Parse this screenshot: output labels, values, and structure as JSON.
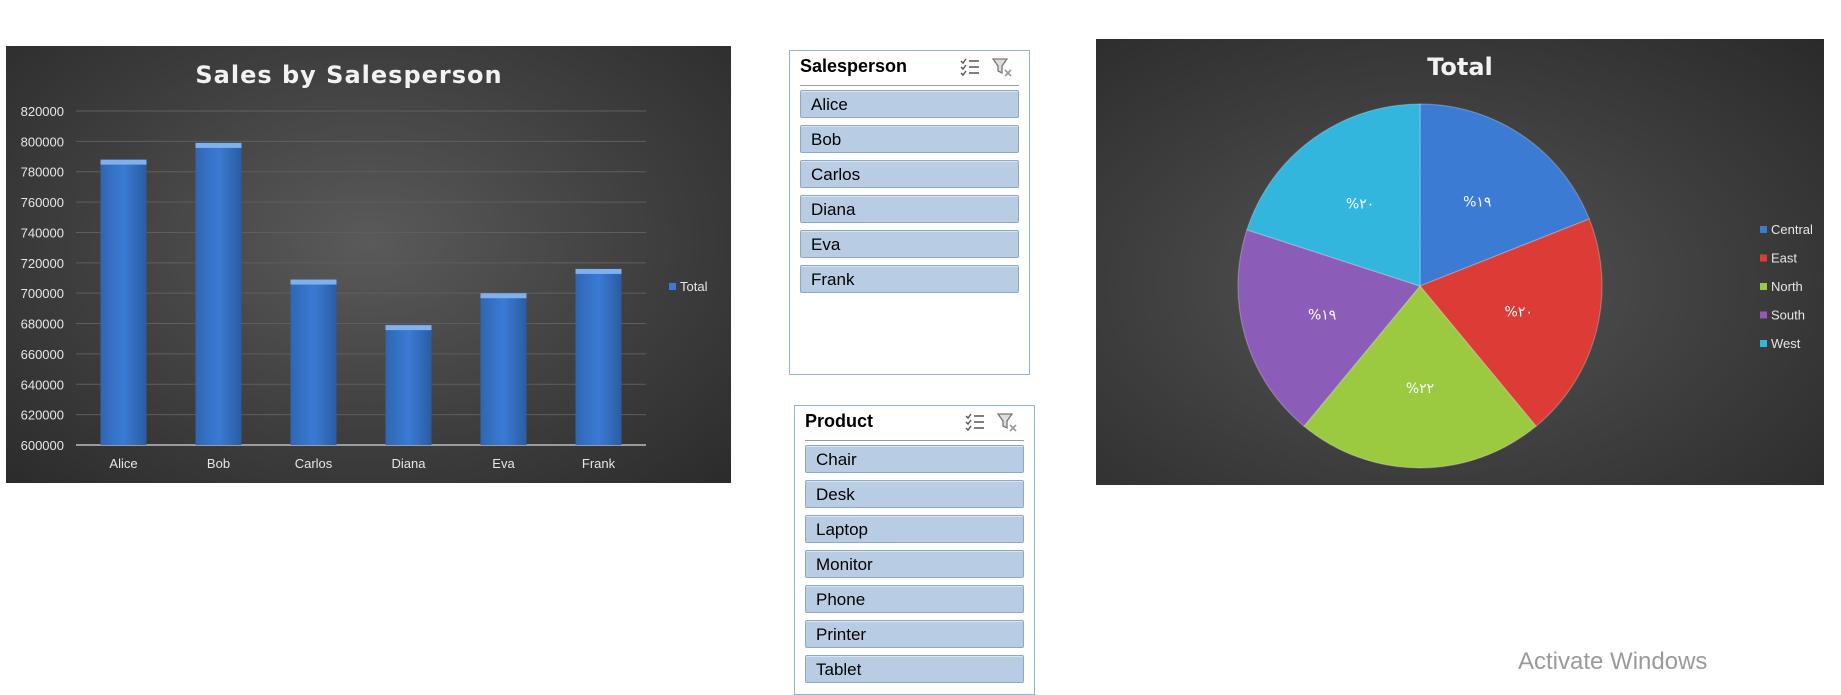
{
  "chart_data": [
    {
      "type": "bar",
      "title": "Sales by Salesperson",
      "categories": [
        "Alice",
        "Bob",
        "Carlos",
        "Diana",
        "Eva",
        "Frank"
      ],
      "series": [
        {
          "name": "Total",
          "values": [
            786000,
            797000,
            707000,
            677000,
            698000,
            714000
          ]
        }
      ],
      "ylim": [
        600000,
        820000
      ],
      "yticks": [
        "600000",
        "620000",
        "640000",
        "660000",
        "680000",
        "700000",
        "720000",
        "740000",
        "760000",
        "780000",
        "800000",
        "820000"
      ],
      "grid": true,
      "legend_position": "right",
      "colors": {
        "bar": "#3b7bd4",
        "background": "#404040",
        "text": "#ffffff"
      }
    },
    {
      "type": "pie",
      "title": "Total",
      "categories": [
        "Central",
        "East",
        "North",
        "South",
        "West"
      ],
      "values": [
        19,
        20,
        22,
        19,
        20
      ],
      "data_labels": [
        "%۱۹",
        "%۲۰",
        "%۲۲",
        "%۱۹",
        "%۲۰"
      ],
      "legend_position": "right",
      "colors": [
        "#3b7bd4",
        "#dd3b35",
        "#9bc940",
        "#8b5db8",
        "#33b6de"
      ]
    }
  ],
  "slicers": [
    {
      "title": "Salesperson",
      "items": [
        "Alice",
        "Bob",
        "Carlos",
        "Diana",
        "Eva",
        "Frank"
      ]
    },
    {
      "title": "Product",
      "items": [
        "Chair",
        "Desk",
        "Laptop",
        "Monitor",
        "Phone",
        "Printer",
        "Tablet"
      ]
    }
  ],
  "watermark": "Activate Windows",
  "icons": {
    "multi_select": "multi-select-icon",
    "clear_filter": "clear-filter-icon"
  }
}
